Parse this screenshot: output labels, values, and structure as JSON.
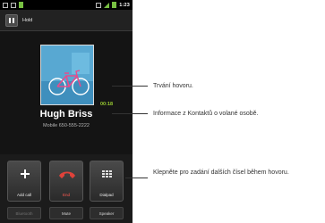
{
  "status_bar": {
    "time": "1:23"
  },
  "hold": {
    "label": "Hold"
  },
  "call": {
    "timer": "00:18",
    "contact_name": "Hugh Briss",
    "contact_number": "Mobile 650-555-2222"
  },
  "actions": {
    "add_call": "Add call",
    "end": "End",
    "dialpad": "Dialpad",
    "bluetooth": "Bluetooth",
    "mute": "Mute",
    "speaker": "Speaker"
  },
  "callouts": {
    "duration": "Trvání hovoru.",
    "contact_info": "Informace z Kontaktů o volané osobě.",
    "dialpad_hint": "Klepněte pro zadání dalších čísel během hovoru."
  },
  "colors": {
    "end_red": "#e0423a",
    "timer_green": "#9acd32",
    "status_green": "#78c042"
  }
}
